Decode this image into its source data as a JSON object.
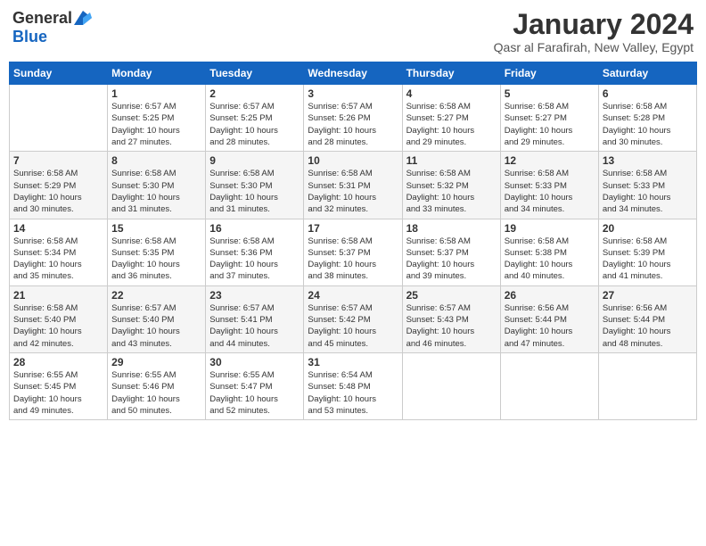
{
  "logo": {
    "general": "General",
    "blue": "Blue"
  },
  "title": "January 2024",
  "location": "Qasr al Farafirah, New Valley, Egypt",
  "days_of_week": [
    "Sunday",
    "Monday",
    "Tuesday",
    "Wednesday",
    "Thursday",
    "Friday",
    "Saturday"
  ],
  "weeks": [
    [
      {
        "day": "",
        "info": ""
      },
      {
        "day": "1",
        "info": "Sunrise: 6:57 AM\nSunset: 5:25 PM\nDaylight: 10 hours\nand 27 minutes."
      },
      {
        "day": "2",
        "info": "Sunrise: 6:57 AM\nSunset: 5:25 PM\nDaylight: 10 hours\nand 28 minutes."
      },
      {
        "day": "3",
        "info": "Sunrise: 6:57 AM\nSunset: 5:26 PM\nDaylight: 10 hours\nand 28 minutes."
      },
      {
        "day": "4",
        "info": "Sunrise: 6:58 AM\nSunset: 5:27 PM\nDaylight: 10 hours\nand 29 minutes."
      },
      {
        "day": "5",
        "info": "Sunrise: 6:58 AM\nSunset: 5:27 PM\nDaylight: 10 hours\nand 29 minutes."
      },
      {
        "day": "6",
        "info": "Sunrise: 6:58 AM\nSunset: 5:28 PM\nDaylight: 10 hours\nand 30 minutes."
      }
    ],
    [
      {
        "day": "7",
        "info": "Sunrise: 6:58 AM\nSunset: 5:29 PM\nDaylight: 10 hours\nand 30 minutes."
      },
      {
        "day": "8",
        "info": "Sunrise: 6:58 AM\nSunset: 5:30 PM\nDaylight: 10 hours\nand 31 minutes."
      },
      {
        "day": "9",
        "info": "Sunrise: 6:58 AM\nSunset: 5:30 PM\nDaylight: 10 hours\nand 31 minutes."
      },
      {
        "day": "10",
        "info": "Sunrise: 6:58 AM\nSunset: 5:31 PM\nDaylight: 10 hours\nand 32 minutes."
      },
      {
        "day": "11",
        "info": "Sunrise: 6:58 AM\nSunset: 5:32 PM\nDaylight: 10 hours\nand 33 minutes."
      },
      {
        "day": "12",
        "info": "Sunrise: 6:58 AM\nSunset: 5:33 PM\nDaylight: 10 hours\nand 34 minutes."
      },
      {
        "day": "13",
        "info": "Sunrise: 6:58 AM\nSunset: 5:33 PM\nDaylight: 10 hours\nand 34 minutes."
      }
    ],
    [
      {
        "day": "14",
        "info": "Sunrise: 6:58 AM\nSunset: 5:34 PM\nDaylight: 10 hours\nand 35 minutes."
      },
      {
        "day": "15",
        "info": "Sunrise: 6:58 AM\nSunset: 5:35 PM\nDaylight: 10 hours\nand 36 minutes."
      },
      {
        "day": "16",
        "info": "Sunrise: 6:58 AM\nSunset: 5:36 PM\nDaylight: 10 hours\nand 37 minutes."
      },
      {
        "day": "17",
        "info": "Sunrise: 6:58 AM\nSunset: 5:37 PM\nDaylight: 10 hours\nand 38 minutes."
      },
      {
        "day": "18",
        "info": "Sunrise: 6:58 AM\nSunset: 5:37 PM\nDaylight: 10 hours\nand 39 minutes."
      },
      {
        "day": "19",
        "info": "Sunrise: 6:58 AM\nSunset: 5:38 PM\nDaylight: 10 hours\nand 40 minutes."
      },
      {
        "day": "20",
        "info": "Sunrise: 6:58 AM\nSunset: 5:39 PM\nDaylight: 10 hours\nand 41 minutes."
      }
    ],
    [
      {
        "day": "21",
        "info": "Sunrise: 6:58 AM\nSunset: 5:40 PM\nDaylight: 10 hours\nand 42 minutes."
      },
      {
        "day": "22",
        "info": "Sunrise: 6:57 AM\nSunset: 5:40 PM\nDaylight: 10 hours\nand 43 minutes."
      },
      {
        "day": "23",
        "info": "Sunrise: 6:57 AM\nSunset: 5:41 PM\nDaylight: 10 hours\nand 44 minutes."
      },
      {
        "day": "24",
        "info": "Sunrise: 6:57 AM\nSunset: 5:42 PM\nDaylight: 10 hours\nand 45 minutes."
      },
      {
        "day": "25",
        "info": "Sunrise: 6:57 AM\nSunset: 5:43 PM\nDaylight: 10 hours\nand 46 minutes."
      },
      {
        "day": "26",
        "info": "Sunrise: 6:56 AM\nSunset: 5:44 PM\nDaylight: 10 hours\nand 47 minutes."
      },
      {
        "day": "27",
        "info": "Sunrise: 6:56 AM\nSunset: 5:44 PM\nDaylight: 10 hours\nand 48 minutes."
      }
    ],
    [
      {
        "day": "28",
        "info": "Sunrise: 6:55 AM\nSunset: 5:45 PM\nDaylight: 10 hours\nand 49 minutes."
      },
      {
        "day": "29",
        "info": "Sunrise: 6:55 AM\nSunset: 5:46 PM\nDaylight: 10 hours\nand 50 minutes."
      },
      {
        "day": "30",
        "info": "Sunrise: 6:55 AM\nSunset: 5:47 PM\nDaylight: 10 hours\nand 52 minutes."
      },
      {
        "day": "31",
        "info": "Sunrise: 6:54 AM\nSunset: 5:48 PM\nDaylight: 10 hours\nand 53 minutes."
      },
      {
        "day": "",
        "info": ""
      },
      {
        "day": "",
        "info": ""
      },
      {
        "day": "",
        "info": ""
      }
    ]
  ]
}
